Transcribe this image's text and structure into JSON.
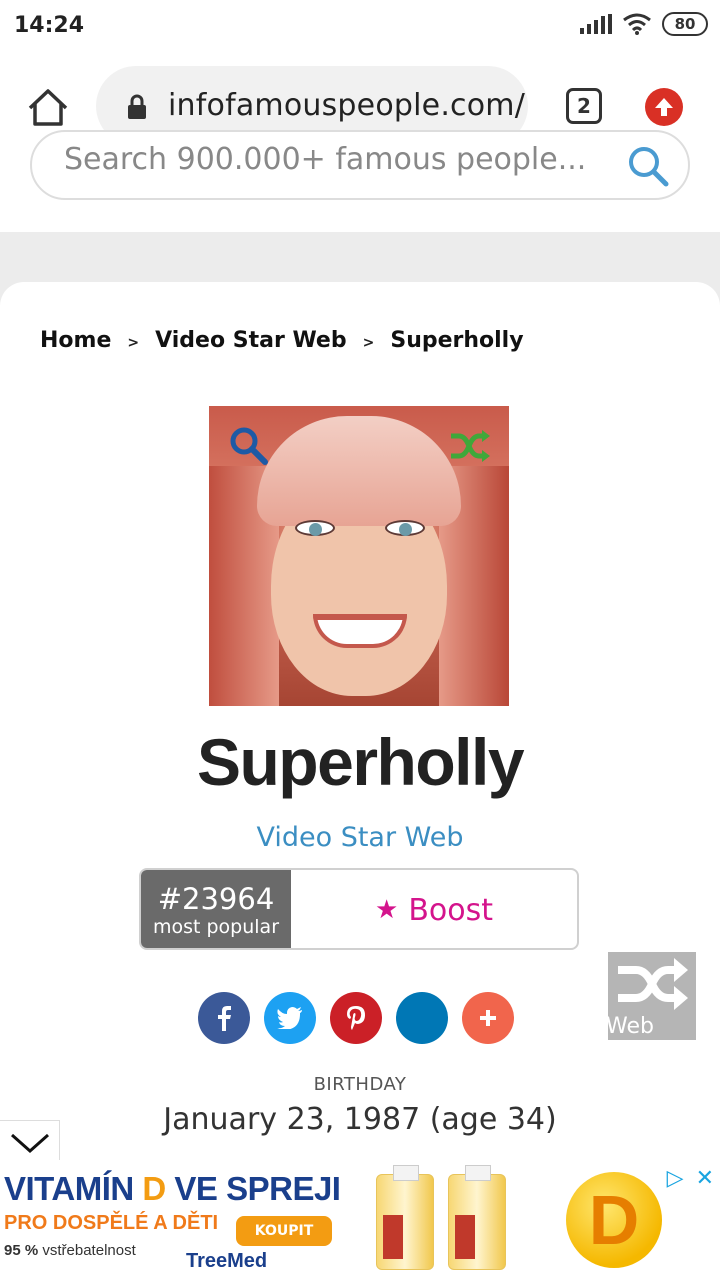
{
  "status_bar": {
    "time": "14:24",
    "battery": "80"
  },
  "browser": {
    "url": "infofamouspeople.com/",
    "tab_count": "2"
  },
  "search": {
    "placeholder": "Search 900.000+ famous people..."
  },
  "breadcrumb": {
    "home": "Home",
    "category": "Video Star Web",
    "current": "Superholly",
    "separator": ">"
  },
  "profile": {
    "name": "Superholly",
    "category": "Video Star Web",
    "rank": "#23964",
    "rank_label": "most popular",
    "boost_label": "Boost",
    "boost_icon": "★",
    "birthday_label": "BIRTHDAY",
    "birthday_value": "January 23, 1987 (age 34)"
  },
  "social": [
    {
      "name": "facebook",
      "glyph": "f",
      "color": "#3b5998"
    },
    {
      "name": "twitter",
      "glyph": "t",
      "color": "#1da1f2"
    },
    {
      "name": "pinterest",
      "glyph": "p",
      "color": "#cb2027"
    },
    {
      "name": "linkedin",
      "glyph": "",
      "color": "#0077b5"
    },
    {
      "name": "more",
      "glyph": "+",
      "color": "#f1654c"
    }
  ],
  "floating_shuffle": {
    "label": "Web"
  },
  "ad": {
    "title_part1": "VITAMÍN ",
    "title_d": "D",
    "title_part2": " VE SPREJI",
    "subtitle": "PRO DOSPĚLÉ A DĚTI",
    "button": "KOUPIT",
    "stat_pct": "95 %",
    "stat_text": " vstřebatelnost",
    "brand": "TreeMed",
    "logo_letter": "D",
    "play_icon": "▷",
    "close_icon": "✕"
  },
  "colors": {
    "accent_link": "#3b8ec2",
    "boost": "#d4148c",
    "rank_bg": "#6a6a6a",
    "update_btn": "#d93025"
  }
}
